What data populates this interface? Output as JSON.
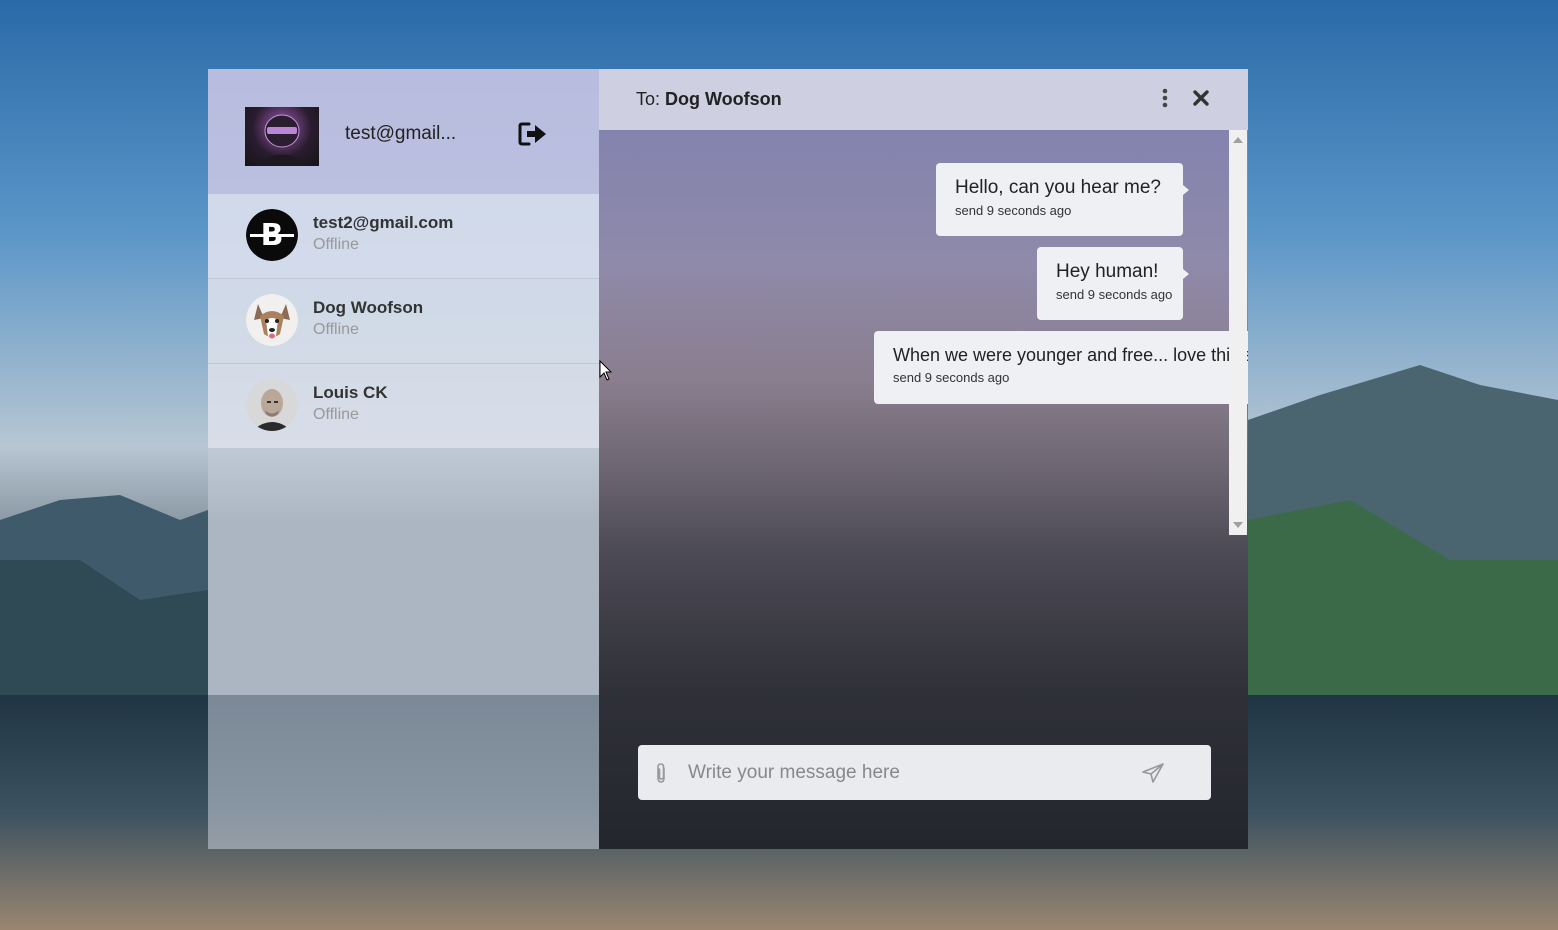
{
  "profile": {
    "email": "test@gmail..."
  },
  "contacts": [
    {
      "name": "test2@gmail.com",
      "status": "Offline"
    },
    {
      "name": "Dog Woofson",
      "status": "Offline"
    },
    {
      "name": "Louis CK",
      "status": "Offline"
    }
  ],
  "chat": {
    "to_label": "To:",
    "recipient": "Dog Woofson",
    "messages": [
      {
        "text": "Hello, can you hear me?",
        "time": "send 9 seconds ago"
      },
      {
        "text": "Hey human!",
        "time": "send 9 seconds ago"
      },
      {
        "text": "When we were younger and free... love this song) woof",
        "time": "send 9 seconds ago"
      }
    ]
  },
  "composer": {
    "placeholder": "Write your message here"
  },
  "icons": {
    "logout": "sign-out-icon",
    "more": "more-vertical-icon",
    "close": "close-icon",
    "attach": "paperclip-icon",
    "send": "send-icon"
  }
}
